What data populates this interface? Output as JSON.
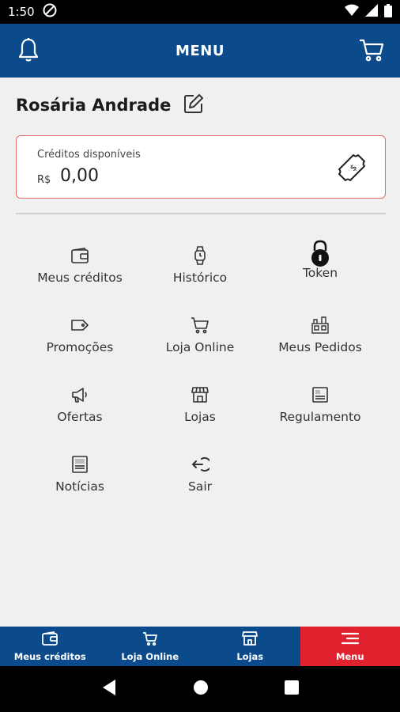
{
  "status_bar": {
    "time": "1:50"
  },
  "header": {
    "title": "MENU",
    "left_icon": "bell-icon",
    "right_icon": "cart-icon"
  },
  "user": {
    "name": "Rosária Andrade",
    "edit_icon": "edit-icon"
  },
  "credits": {
    "label": "Créditos disponíveis",
    "currency": "R$",
    "value": "0,00",
    "icon": "money-ticket-icon"
  },
  "menu": {
    "items": [
      {
        "label": "Meus créditos",
        "icon": "wallet-icon"
      },
      {
        "label": "Histórico",
        "icon": "watch-icon"
      },
      {
        "label": "Token",
        "icon": "lock-icon"
      },
      {
        "label": "Promoções",
        "icon": "tag-icon"
      },
      {
        "label": "Loja Online",
        "icon": "cart-icon"
      },
      {
        "label": "Meus Pedidos",
        "icon": "orders-icon"
      },
      {
        "label": "Ofertas",
        "icon": "megaphone-icon"
      },
      {
        "label": "Lojas",
        "icon": "store-icon"
      },
      {
        "label": "Regulamento",
        "icon": "document-icon"
      },
      {
        "label": "Notícias",
        "icon": "news-icon"
      },
      {
        "label": "Sair",
        "icon": "logout-icon"
      }
    ]
  },
  "bottom_nav": {
    "items": [
      {
        "label": "Meus créditos",
        "icon": "wallet-icon"
      },
      {
        "label": "Loja Online",
        "icon": "cart-icon"
      },
      {
        "label": "Lojas",
        "icon": "store-icon"
      },
      {
        "label": "Menu",
        "icon": "menu-icon"
      }
    ],
    "active": "Menu"
  },
  "colors": {
    "primary": "#0b4a8b",
    "accent": "#e0222f",
    "card_border": "#e26b6b"
  }
}
